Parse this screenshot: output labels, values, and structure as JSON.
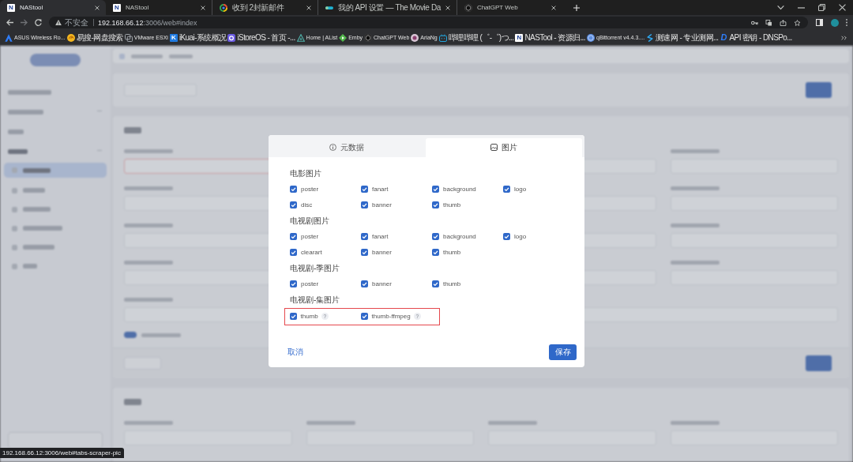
{
  "browser": {
    "tabs": [
      {
        "title": "NAStool",
        "kind": "plate",
        "mark": "N",
        "selected": true
      },
      {
        "title": "NAStool",
        "kind": "plate",
        "mark": "N",
        "selected": false
      },
      {
        "title": "收到 2封新邮件",
        "kind": "ring",
        "selected": false
      },
      {
        "title": "我的 API 设置 — The Movie Da",
        "kind": "bar",
        "selected": false
      },
      {
        "title": "ChatGPT Web",
        "kind": "knot",
        "selected": false
      }
    ],
    "address": {
      "security": "不安全",
      "host": "192.168.66.12",
      "path": ":3006/web#index"
    },
    "bookmarks": [
      {
        "title": "ASUS Wireless Ro...",
        "kind": "peak"
      },
      {
        "title": "易搜-网盘搜索",
        "kind": "swirl"
      },
      {
        "title": "VMware ESXi",
        "kind": "squares"
      },
      {
        "title": "iKuai-系统概况",
        "kind": "tile",
        "mark": "K"
      },
      {
        "title": "iStoreOS - 首页 -...",
        "kind": "store"
      },
      {
        "title": "Home | AList",
        "kind": "triangle"
      },
      {
        "title": "Emby",
        "kind": "play"
      },
      {
        "title": "ChatGPT Web",
        "kind": "knot"
      },
      {
        "title": "AriaNg",
        "kind": "orb"
      },
      {
        "title": "哔哩哔哩 (゜-゜)つ...",
        "kind": "tv"
      },
      {
        "title": "NASTool - 资源归...",
        "kind": "plate",
        "mark": "N"
      },
      {
        "title": "qBittorrent v4.4.3....",
        "kind": "disc"
      },
      {
        "title": "测速网 - 专业测网...",
        "kind": "bolt"
      },
      {
        "title": "API 密钥 - DNSPo...",
        "kind": "letter",
        "mark": "D"
      }
    ]
  },
  "page_behind": {
    "blurred": true
  },
  "dialog": {
    "tabs": [
      {
        "label": "元数据",
        "kind": "info",
        "selected": false
      },
      {
        "label": "图片",
        "kind": "image",
        "selected": true
      }
    ],
    "sections": [
      {
        "title": "电影图片",
        "highlighted": false,
        "options": [
          {
            "label": "poster",
            "checked": true
          },
          {
            "label": "fanart",
            "checked": true
          },
          {
            "label": "background",
            "checked": true
          },
          {
            "label": "logo",
            "checked": true
          },
          {
            "label": "disc",
            "checked": true
          },
          {
            "label": "banner",
            "checked": true
          },
          {
            "label": "thumb",
            "checked": true
          }
        ]
      },
      {
        "title": "电视剧图片",
        "highlighted": false,
        "options": [
          {
            "label": "poster",
            "checked": true
          },
          {
            "label": "fanart",
            "checked": true
          },
          {
            "label": "background",
            "checked": true
          },
          {
            "label": "logo",
            "checked": true
          },
          {
            "label": "clearart",
            "checked": true
          },
          {
            "label": "banner",
            "checked": true
          },
          {
            "label": "thumb",
            "checked": true
          }
        ]
      },
      {
        "title": "电视剧-季图片",
        "highlighted": false,
        "options": [
          {
            "label": "poster",
            "checked": true
          },
          {
            "label": "banner",
            "checked": true
          },
          {
            "label": "thumb",
            "checked": true
          }
        ]
      },
      {
        "title": "电视剧-集图片",
        "highlighted": true,
        "options": [
          {
            "label": "thumb",
            "checked": true,
            "hint": "?"
          },
          {
            "label": "thumb-ffmpeg",
            "checked": true,
            "hint": "?"
          }
        ]
      }
    ],
    "cancel": "取消",
    "save": "保存"
  },
  "status_link": "192.168.66.12:3006/web#tabs-scraper-pic"
}
